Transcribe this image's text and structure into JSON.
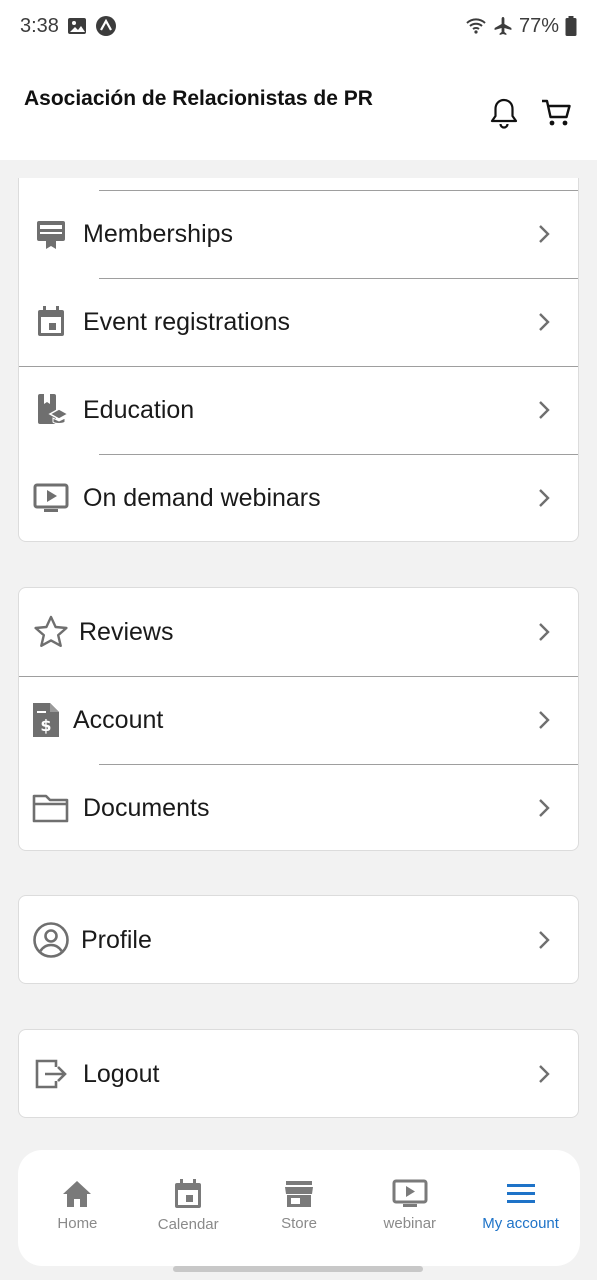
{
  "status_bar": {
    "time": "3:38",
    "battery": "77%"
  },
  "header": {
    "title": "Asociación de Relacionistas de PR"
  },
  "menu_group_1": [
    {
      "label": "Memberships",
      "icon": "membership-card-icon"
    },
    {
      "label": "Event registrations",
      "icon": "calendar-event-icon"
    },
    {
      "label": "Education",
      "icon": "education-icon"
    },
    {
      "label": "On demand webinars",
      "icon": "video-play-icon"
    }
  ],
  "menu_group_2": [
    {
      "label": "Reviews",
      "icon": "star-icon"
    },
    {
      "label": "Account",
      "icon": "invoice-icon"
    },
    {
      "label": "Documents",
      "icon": "folder-icon"
    }
  ],
  "menu_group_3": [
    {
      "label": "Profile",
      "icon": "user-circle-icon"
    }
  ],
  "menu_group_4": [
    {
      "label": "Logout",
      "icon": "logout-icon"
    }
  ],
  "bottom_nav": [
    {
      "label": "Home",
      "icon": "home-icon",
      "active": false
    },
    {
      "label": "Calendar",
      "icon": "calendar-icon",
      "active": false
    },
    {
      "label": "Store",
      "icon": "store-icon",
      "active": false
    },
    {
      "label": "webinar",
      "icon": "webinar-icon",
      "active": false
    },
    {
      "label": "My account",
      "icon": "menu-icon",
      "active": true
    }
  ],
  "colors": {
    "accent": "#1e73c8",
    "icon_gray": "#6f6f6f",
    "nav_gray": "#8a8a8a"
  }
}
